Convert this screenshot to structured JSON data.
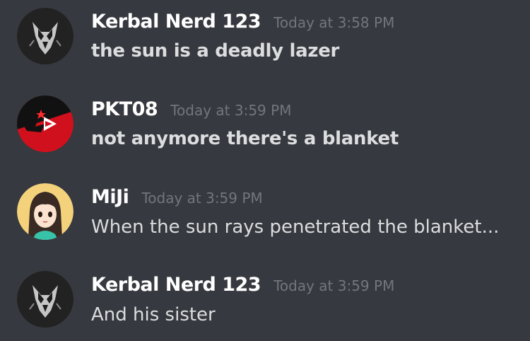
{
  "messages": [
    {
      "author": "Kerbal Nerd 123",
      "timestamp": "Today at 3:58 PM",
      "text": "the sun is a deadly lazer",
      "avatar_icon": "wolf-logo-icon",
      "text_bold": true
    },
    {
      "author": "PKT08",
      "timestamp": "Today at 3:59 PM",
      "text": "not anymore there's a blanket",
      "avatar_icon": "red-play-logo-icon",
      "text_bold": true
    },
    {
      "author": "MiJi",
      "timestamp": "Today at 3:59 PM",
      "text": "When the sun rays penetrated the blanket...",
      "avatar_icon": "anime-girl-avatar-icon",
      "text_bold": false
    },
    {
      "author": "Kerbal Nerd 123",
      "timestamp": "Today at 3:59 PM",
      "text": "And his sister",
      "avatar_icon": "wolf-logo-icon",
      "text_bold": false
    }
  ],
  "colors": {
    "background": "#36393f",
    "username": "#ffffff",
    "timestamp": "#72767d",
    "message_text": "#dcddde"
  }
}
